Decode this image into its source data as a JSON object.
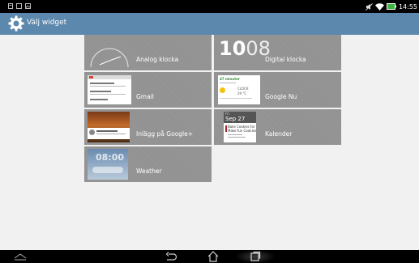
{
  "status_bar": {
    "time": "14:55",
    "left_icons": [
      "notification-icon",
      "screenshot-icon",
      "photo-icon"
    ],
    "right_icons": [
      "mute-icon",
      "wifi-icon",
      "battery-icon"
    ]
  },
  "title_bar": {
    "title": "Välj widget",
    "icon": "settings-gear-icon"
  },
  "widgets": [
    {
      "label": "Analog klocka"
    },
    {
      "label": "Digital klocka",
      "preview": {
        "hour": "10",
        "minute": "08"
      }
    },
    {
      "label": "Gmail"
    },
    {
      "label": "Google Nu",
      "preview": {
        "steps": "47 minuter",
        "temp_title": "CLOCK",
        "temp": "29 °C"
      }
    },
    {
      "label": "Inlägg på Google+"
    },
    {
      "label": "Kalender",
      "preview": {
        "day_abbr": "Fri",
        "date": "Sep 27",
        "event_title": "Bake Cookies for",
        "event_title2": "Make fun Cookies"
      }
    },
    {
      "label": "Weather",
      "preview": {
        "time": "08:00"
      }
    }
  ],
  "nav_bar": {
    "buttons": [
      "back-icon",
      "home-icon",
      "recent-apps-icon"
    ],
    "left_icon": "expand-icon"
  }
}
